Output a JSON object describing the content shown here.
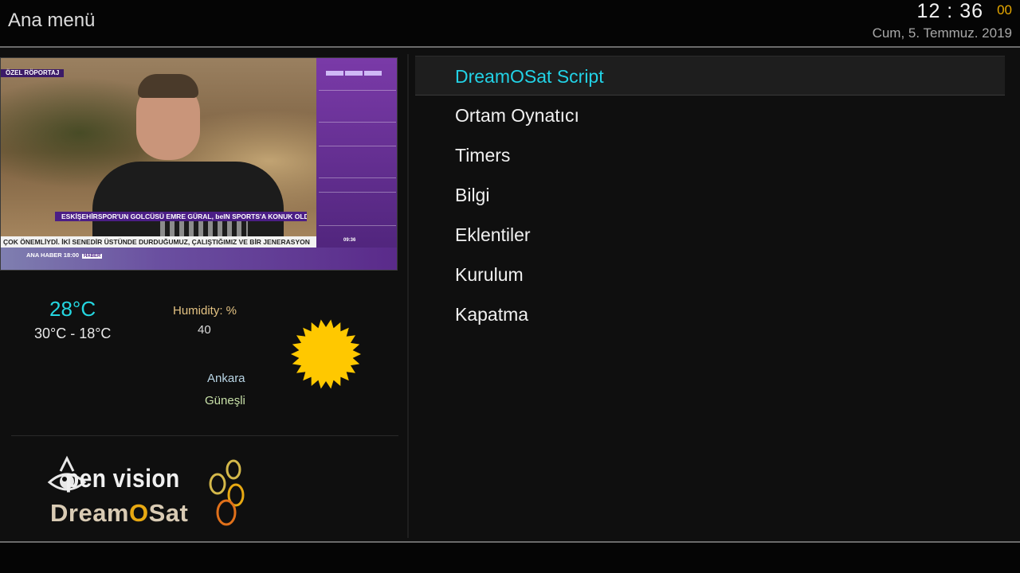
{
  "header": {
    "title": "Ana menü",
    "clock_hm": "12 : 36",
    "clock_sec": "00",
    "date": "Cum,  5. Temmuz. 2019"
  },
  "preview": {
    "tag": "ÖZEL RÖPORTAJ",
    "headline": "ESKİŞEHİRSPOR'UN GOLCÜSÜ EMRE GÜRAL, beIN SPORTS'A KONUK OLDU",
    "ticker": "ÇOK ÖNEMLİYDİ. İKİ SENEDİR ÜSTÜNDE DURDUĞUMUZ, ÇALIŞTIĞIMIZ VE BİR JENERASYON",
    "show": "ANA HABER   18:00",
    "show_badge": "HABER",
    "side_time": "09:36"
  },
  "weather": {
    "temperature": "28°C",
    "range": "30°C - 18°C",
    "humidity_label": "Humidity: %",
    "humidity_value": "40",
    "city": "Ankara",
    "condition": "Güneşli",
    "icon": "sun-icon"
  },
  "logo": {
    "line1": "pen vision",
    "line2_a": "Dream",
    "line2_o": "O",
    "line2_b": "Sat"
  },
  "menu": {
    "items": [
      {
        "label": "DreamOSat Script",
        "selected": true
      },
      {
        "label": "Ortam Oynatıcı"
      },
      {
        "label": "Timers"
      },
      {
        "label": "Bilgi"
      },
      {
        "label": "Eklentiler"
      },
      {
        "label": "Kurulum"
      },
      {
        "label": "Kapatma"
      }
    ]
  },
  "colors": {
    "accent": "#22d2e6",
    "clock_seconds": "#e6a800",
    "sun": "#ffc800"
  }
}
